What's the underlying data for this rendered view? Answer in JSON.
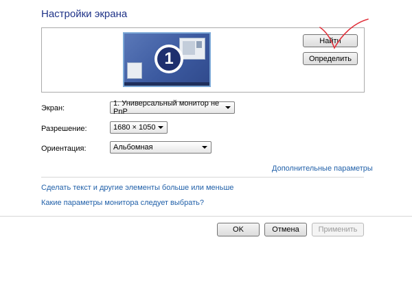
{
  "page": {
    "title": "Настройки экрана"
  },
  "preview": {
    "buttons": {
      "find": "Найти",
      "identify": "Определить"
    },
    "monitor_number": "1"
  },
  "form": {
    "screen": {
      "label": "Экран:",
      "value": "1. Универсальный монитор не PnP"
    },
    "resolution": {
      "label": "Разрешение:",
      "value": "1680 × 1050"
    },
    "orientation": {
      "label": "Ориентация:",
      "value": "Альбомная"
    }
  },
  "links": {
    "advanced": "Дополнительные параметры",
    "text_size": "Сделать текст и другие элементы больше или меньше",
    "which_settings": "Какие параметры монитора следует выбрать?"
  },
  "footer": {
    "ok": "OK",
    "cancel": "Отмена",
    "apply": "Применить"
  },
  "colors": {
    "title": "#1e3287",
    "link": "#1f5fa8",
    "annotation": "#e0303a"
  },
  "icons": [
    "monitor-preview-icon",
    "dropdown-arrow-icon",
    "red-checkmark-annotation"
  ]
}
